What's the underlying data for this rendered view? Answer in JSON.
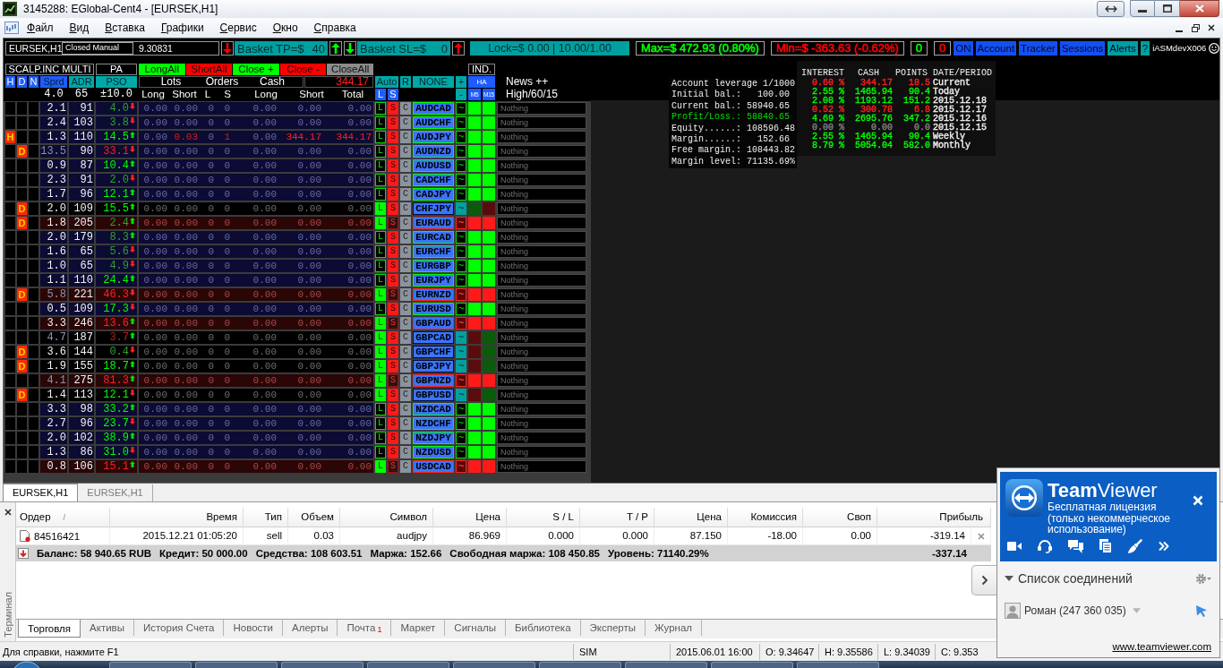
{
  "window": {
    "title": "3145288: EGlobal-Cent4 - [EURSEK,H1]"
  },
  "menu": [
    "Файл",
    "Вид",
    "Вставка",
    "Графики",
    "Сервис",
    "Окно",
    "Справка"
  ],
  "dashboard": {
    "quote": {
      "symbol": "EURSEK,H1",
      "mode": "Closed Manual",
      "price": "9.30831"
    },
    "top_bar": [
      {
        "kind": "down",
        "color": "#ff0000"
      },
      {
        "kind": "basket",
        "label": "Basket TP=$",
        "value": "40"
      },
      {
        "kind": "up",
        "color": "#00ff00"
      },
      {
        "kind": "down",
        "color": "#00ff00"
      },
      {
        "kind": "basket",
        "label": "Basket SL=$",
        "value": "0"
      },
      {
        "kind": "up",
        "color": "#ff0000"
      },
      {
        "kind": "display",
        "text": "Lock=$ 0.00 | 10.00/1.00"
      },
      {
        "kind": "stat",
        "text": "Max=$ 472.93 (0.80%)",
        "color": "#00ff00"
      },
      {
        "kind": "stat",
        "text": "Min=$ -363.63 (-0.62%)",
        "color": "#ff0000"
      },
      {
        "kind": "stat",
        "text": "0",
        "color": "#00ff00"
      },
      {
        "kind": "stat",
        "text": "0",
        "color": "#ff0000"
      },
      {
        "kind": "button",
        "text": "ON",
        "color": "#1450f0"
      },
      {
        "kind": "button",
        "text": "Account",
        "color": "#1450f0"
      },
      {
        "kind": "button",
        "text": "Tracker",
        "color": "#1450f0"
      },
      {
        "kind": "button",
        "text": "Sessions",
        "color": "#1450f0"
      },
      {
        "kind": "button",
        "text": "Alerts",
        "color": "#00a0a0"
      },
      {
        "kind": "button",
        "text": "?",
        "color": "#00a0a0"
      }
    ],
    "user": "iASMdevX006",
    "header": {
      "title": "SCALP.INC MULTI",
      "pa": "PA",
      "actions": [
        {
          "label": "LongAll",
          "color": "#00ff00"
        },
        {
          "label": "ShortAll",
          "color": "#ff0000"
        },
        {
          "label": "Close +",
          "color": "#00ff00"
        },
        {
          "label": "Close -",
          "color": "#ff0000"
        },
        {
          "label": "CloseAll",
          "color": "#8c8c8c"
        }
      ],
      "ind": "IND.",
      "flags": [
        "H",
        "D",
        "N"
      ],
      "metrics": [
        {
          "label": "Sprd",
          "value": "4.0",
          "color": "#1f5cff"
        },
        {
          "label": "ADR",
          "value": "65",
          "color": "#00a8a8"
        },
        {
          "label": "PSO",
          "value": "±10.0",
          "color": "#00a8a8"
        }
      ],
      "groups": [
        "Lots",
        "Orders",
        "Cash"
      ],
      "cash_total": "344.17",
      "subcolumns": [
        "Long",
        "Short",
        "L",
        "S",
        "Long",
        "Short",
        "Total"
      ],
      "mode_buttons": [
        "Auto",
        "R",
        "NONE",
        "+"
      ],
      "sides": [
        "L",
        "S"
      ],
      "minus": "-",
      "ha": "HA",
      "timeframes": [
        "M5",
        "M15"
      ],
      "news": "News ++",
      "news_filter": "High/60/15"
    },
    "rows": [
      {
        "symbol": "AUDCAD",
        "kind": "buy",
        "sprd": "2.1",
        "sprd_high": false,
        "adr": "91",
        "pso": {
          "value": "4.0",
          "bullish": true,
          "strong": false,
          "rising": false
        },
        "values": [
          "0.00",
          "0.00",
          "0",
          "0",
          "0.00",
          "0.00",
          "0.00"
        ],
        "short_open": false,
        "actions": [
          "L",
          "S",
          "C"
        ],
        "mode": "~",
        "ha": [
          {
            "color": "#00ff00"
          },
          {
            "color": "#00ff00"
          }
        ],
        "news": "Nothing"
      },
      {
        "symbol": "AUDCHF",
        "kind": "buy",
        "sprd": "2.4",
        "sprd_high": false,
        "adr": "103",
        "pso": {
          "value": "3.8",
          "bullish": true,
          "strong": false,
          "rising": false
        },
        "values": [
          "0.00",
          "0.00",
          "0",
          "0",
          "0.00",
          "0.00",
          "0.00"
        ],
        "short_open": false,
        "actions": [
          "L",
          "S",
          "C"
        ],
        "mode": "~",
        "ha": [
          {
            "color": "#00ff00"
          },
          {
            "color": "#00ff00"
          }
        ],
        "news": "Nothing"
      },
      {
        "symbol": "AUDJPY",
        "kind": "buy",
        "h_mark": "H",
        "sprd": "1.3",
        "sprd_high": false,
        "adr": "110",
        "pso": {
          "value": "14.5",
          "bullish": true,
          "strong": true,
          "rising": true
        },
        "values": [
          "0.00",
          "0.03",
          "0",
          "1",
          "0.00",
          "344.17",
          "344.17"
        ],
        "short_open": true,
        "actions": [
          "L",
          "S",
          "C"
        ],
        "mode": "~",
        "ha": [
          {
            "color": "#00ff00"
          },
          {
            "color": "#00ff00"
          }
        ],
        "news": "Nothing"
      },
      {
        "symbol": "AUDNZD",
        "kind": "buy",
        "d_mark": "D",
        "sprd": "13.5",
        "sprd_high": true,
        "adr": "90",
        "pso": {
          "value": "33.1",
          "bullish": false,
          "strong": true,
          "rising": false
        },
        "values": [
          "0.00",
          "0.00",
          "0",
          "0",
          "0.00",
          "0.00",
          "0.00"
        ],
        "short_open": false,
        "actions": [
          "L",
          "S",
          "C"
        ],
        "mode": "~",
        "ha": [
          {
            "color": "#00ff00"
          },
          {
            "color": "#00ff00"
          }
        ],
        "news": "Nothing"
      },
      {
        "symbol": "AUDUSD",
        "kind": "buy",
        "sprd": "0.9",
        "sprd_high": false,
        "adr": "87",
        "pso": {
          "value": "10.4",
          "bullish": true,
          "strong": true,
          "rising": true
        },
        "values": [
          "0.00",
          "0.00",
          "0",
          "0",
          "0.00",
          "0.00",
          "0.00"
        ],
        "short_open": false,
        "actions": [
          "L",
          "S",
          "C"
        ],
        "mode": "~",
        "ha": [
          {
            "color": "#00ff00"
          },
          {
            "color": "#00ff00"
          }
        ],
        "news": "Nothing"
      },
      {
        "symbol": "CADCHF",
        "kind": "buy",
        "sprd": "2.3",
        "sprd_high": false,
        "adr": "91",
        "pso": {
          "value": "2.0",
          "bullish": true,
          "strong": false,
          "rising": false
        },
        "values": [
          "0.00",
          "0.00",
          "0",
          "0",
          "0.00",
          "0.00",
          "0.00"
        ],
        "short_open": false,
        "actions": [
          "L",
          "S",
          "C"
        ],
        "mode": "~",
        "ha": [
          {
            "color": "#00ff00"
          },
          {
            "color": "#00ff00"
          }
        ],
        "news": "Nothing"
      },
      {
        "symbol": "CADJPY",
        "kind": "buy",
        "sprd": "1.7",
        "sprd_high": false,
        "adr": "96",
        "pso": {
          "value": "12.1",
          "bullish": true,
          "strong": true,
          "rising": true
        },
        "values": [
          "0.00",
          "0.00",
          "0",
          "0",
          "0.00",
          "0.00",
          "0.00"
        ],
        "short_open": false,
        "actions": [
          "L",
          "S",
          "C"
        ],
        "mode": "~",
        "ha": [
          {
            "color": "#00ff00"
          },
          {
            "color": "#00ff00"
          }
        ],
        "news": "Nothing"
      },
      {
        "symbol": "CHFJPY",
        "kind": "flat",
        "d_mark": "D",
        "sprd": "2.0",
        "sprd_high": false,
        "adr": "109",
        "pso": {
          "value": "15.5",
          "bullish": true,
          "strong": true,
          "rising": true
        },
        "values": [
          "0.00",
          "0.00",
          "0",
          "0",
          "0.00",
          "0.00",
          "0.00"
        ],
        "short_open": false,
        "actions": [
          "L",
          "S",
          "C"
        ],
        "mode": "~",
        "ha": [
          {
            "color": "#0c5a0c"
          },
          {
            "color": "#5a0c0c"
          }
        ],
        "news": "Nothing"
      },
      {
        "symbol": "EURAUD",
        "kind": "sell",
        "d_mark": "D",
        "sprd": "1.8",
        "sprd_high": false,
        "adr": "205",
        "pso": {
          "value": "2.4",
          "bullish": true,
          "strong": false,
          "rising": true
        },
        "values": [
          "0.00",
          "0.00",
          "0",
          "0",
          "0.00",
          "0.00",
          "0.00"
        ],
        "short_open": false,
        "actions": [
          "L",
          "S",
          "C"
        ],
        "mode": "~",
        "ha": [
          {
            "color": "#ff1a1a"
          },
          {
            "color": "#ff1a1a"
          }
        ],
        "news": "Nothing"
      },
      {
        "symbol": "EURCAD",
        "kind": "buy",
        "sprd": "2.0",
        "sprd_high": false,
        "adr": "179",
        "pso": {
          "value": "8.3",
          "bullish": true,
          "strong": false,
          "rising": true
        },
        "values": [
          "0.00",
          "0.00",
          "0",
          "0",
          "0.00",
          "0.00",
          "0.00"
        ],
        "short_open": false,
        "actions": [
          "L",
          "S",
          "C"
        ],
        "mode": "~",
        "ha": [
          {
            "color": "#00ff00"
          },
          {
            "color": "#00ff00"
          }
        ],
        "news": "Nothing"
      },
      {
        "symbol": "EURCHF",
        "kind": "buy",
        "sprd": "1.6",
        "sprd_high": false,
        "adr": "65",
        "pso": {
          "value": "5.6",
          "bullish": true,
          "strong": false,
          "rising": false
        },
        "values": [
          "0.00",
          "0.00",
          "0",
          "0",
          "0.00",
          "0.00",
          "0.00"
        ],
        "short_open": false,
        "actions": [
          "L",
          "S",
          "C"
        ],
        "mode": "~",
        "ha": [
          {
            "color": "#00ff00"
          },
          {
            "color": "#00ff00"
          }
        ],
        "news": "Nothing"
      },
      {
        "symbol": "EURGBP",
        "kind": "buy",
        "sprd": "1.0",
        "sprd_high": false,
        "adr": "65",
        "pso": {
          "value": "4.9",
          "bullish": true,
          "strong": false,
          "rising": false
        },
        "values": [
          "0.00",
          "0.00",
          "0",
          "0",
          "0.00",
          "0.00",
          "0.00"
        ],
        "short_open": false,
        "actions": [
          "L",
          "S",
          "C"
        ],
        "mode": "~",
        "ha": [
          {
            "color": "#00ff00"
          },
          {
            "color": "#00ff00"
          }
        ],
        "news": "Nothing"
      },
      {
        "symbol": "EURJPY",
        "kind": "buy",
        "sprd": "1.1",
        "sprd_high": false,
        "adr": "110",
        "pso": {
          "value": "24.4",
          "bullish": true,
          "strong": true,
          "rising": true
        },
        "values": [
          "0.00",
          "0.00",
          "0",
          "0",
          "0.00",
          "0.00",
          "0.00"
        ],
        "short_open": false,
        "actions": [
          "L",
          "S",
          "C"
        ],
        "mode": "~",
        "ha": [
          {
            "color": "#00ff00"
          },
          {
            "color": "#00ff00"
          }
        ],
        "news": "Nothing"
      },
      {
        "symbol": "EURNZD",
        "kind": "sell",
        "d_mark": "D",
        "sprd": "5.8",
        "sprd_high": true,
        "adr": "221",
        "pso": {
          "value": "46.3",
          "bullish": false,
          "strong": true,
          "rising": false
        },
        "values": [
          "0.00",
          "0.00",
          "0",
          "0",
          "0.00",
          "0.00",
          "0.00"
        ],
        "short_open": false,
        "actions": [
          "L",
          "S",
          "C"
        ],
        "mode": "~",
        "ha": [
          {
            "color": "#ff1a1a"
          },
          {
            "color": "#ff1a1a"
          }
        ],
        "news": "Nothing"
      },
      {
        "symbol": "EURUSD",
        "kind": "buy",
        "sprd": "0.5",
        "sprd_high": false,
        "adr": "109",
        "pso": {
          "value": "17.3",
          "bullish": true,
          "strong": true,
          "rising": false
        },
        "values": [
          "0.00",
          "0.00",
          "0",
          "0",
          "0.00",
          "0.00",
          "0.00"
        ],
        "short_open": false,
        "actions": [
          "L",
          "S",
          "C"
        ],
        "mode": "~",
        "ha": [
          {
            "color": "#00ff00"
          },
          {
            "color": "#00ff00"
          }
        ],
        "news": "Nothing"
      },
      {
        "symbol": "GBPAUD",
        "kind": "sell",
        "sprd": "3.3",
        "sprd_high": false,
        "adr": "246",
        "pso": {
          "value": "13.6",
          "bullish": false,
          "strong": true,
          "rising": true
        },
        "values": [
          "0.00",
          "0.00",
          "0",
          "0",
          "0.00",
          "0.00",
          "0.00"
        ],
        "short_open": false,
        "actions": [
          "L",
          "S",
          "C"
        ],
        "mode": "~",
        "ha": [
          {
            "color": "#ff1a1a"
          },
          {
            "color": "#ff1a1a"
          }
        ],
        "news": "Nothing"
      },
      {
        "symbol": "GBPCAD",
        "kind": "flat",
        "sprd": "4.7",
        "sprd_high": true,
        "adr": "187",
        "pso": {
          "value": "3.7",
          "bullish": false,
          "strong": false,
          "rising": true
        },
        "values": [
          "0.00",
          "0.00",
          "0",
          "0",
          "0.00",
          "0.00",
          "0.00"
        ],
        "short_open": false,
        "actions": [
          "L",
          "S",
          "C"
        ],
        "mode": "~",
        "ha": [
          {
            "color": "#5a0c0c"
          },
          {
            "color": "#0c5a0c"
          }
        ],
        "news": "Nothing"
      },
      {
        "symbol": "GBPCHF",
        "kind": "flat",
        "d_mark": "D",
        "sprd": "3.6",
        "sprd_high": false,
        "adr": "144",
        "pso": {
          "value": "0.4",
          "bullish": true,
          "strong": false,
          "rising": false
        },
        "values": [
          "0.00",
          "0.00",
          "0",
          "0",
          "0.00",
          "0.00",
          "0.00"
        ],
        "short_open": false,
        "actions": [
          "L",
          "S",
          "C"
        ],
        "mode": "~",
        "ha": [
          {
            "color": "#5a0c0c"
          },
          {
            "color": "#0c5a0c"
          }
        ],
        "news": "Nothing"
      },
      {
        "symbol": "GBPJPY",
        "kind": "flat",
        "d_mark": "D",
        "sprd": "1.9",
        "sprd_high": false,
        "adr": "155",
        "pso": {
          "value": "18.7",
          "bullish": true,
          "strong": true,
          "rising": true
        },
        "values": [
          "0.00",
          "0.00",
          "0",
          "0",
          "0.00",
          "0.00",
          "0.00"
        ],
        "short_open": false,
        "actions": [
          "L",
          "S",
          "C"
        ],
        "mode": "~",
        "ha": [
          {
            "color": "#5a0c0c"
          },
          {
            "color": "#0c5a0c"
          }
        ],
        "news": "Nothing"
      },
      {
        "symbol": "GBPNZD",
        "kind": "sell",
        "sprd": "4.1",
        "sprd_high": true,
        "adr": "275",
        "pso": {
          "value": "81.3",
          "bullish": false,
          "strong": true,
          "rising": true
        },
        "values": [
          "0.00",
          "0.00",
          "0",
          "0",
          "0.00",
          "0.00",
          "0.00"
        ],
        "short_open": false,
        "actions": [
          "L",
          "S",
          "C"
        ],
        "mode": "~",
        "ha": [
          {
            "color": "#ff1a1a"
          },
          {
            "color": "#ff1a1a"
          }
        ],
        "news": "Nothing"
      },
      {
        "symbol": "GBPUSD",
        "kind": "flat",
        "d_mark": "D",
        "sprd": "1.4",
        "sprd_high": false,
        "adr": "113",
        "pso": {
          "value": "12.1",
          "bullish": true,
          "strong": true,
          "rising": false
        },
        "values": [
          "0.00",
          "0.00",
          "0",
          "0",
          "0.00",
          "0.00",
          "0.00"
        ],
        "short_open": false,
        "actions": [
          "L",
          "S",
          "C"
        ],
        "mode": "~",
        "ha": [
          {
            "color": "#5a0c0c"
          },
          {
            "color": "#0c5a0c"
          }
        ],
        "news": "Nothing"
      },
      {
        "symbol": "NZDCAD",
        "kind": "buy",
        "sprd": "3.3",
        "sprd_high": false,
        "adr": "98",
        "pso": {
          "value": "33.2",
          "bullish": true,
          "strong": true,
          "rising": true
        },
        "values": [
          "0.00",
          "0.00",
          "0",
          "0",
          "0.00",
          "0.00",
          "0.00"
        ],
        "short_open": false,
        "actions": [
          "L",
          "S",
          "C"
        ],
        "mode": "~",
        "ha": [
          {
            "color": "#00ff00"
          },
          {
            "color": "#00ff00"
          }
        ],
        "news": "Nothing"
      },
      {
        "symbol": "NZDCHF",
        "kind": "buy",
        "sprd": "2.7",
        "sprd_high": false,
        "adr": "96",
        "pso": {
          "value": "23.7",
          "bullish": true,
          "strong": true,
          "rising": false
        },
        "values": [
          "0.00",
          "0.00",
          "0",
          "0",
          "0.00",
          "0.00",
          "0.00"
        ],
        "short_open": false,
        "actions": [
          "L",
          "S",
          "C"
        ],
        "mode": "~",
        "ha": [
          {
            "color": "#00ff00"
          },
          {
            "color": "#00ff00"
          }
        ],
        "news": "Nothing"
      },
      {
        "symbol": "NZDJPY",
        "kind": "buy",
        "sprd": "2.0",
        "sprd_high": false,
        "adr": "102",
        "pso": {
          "value": "38.9",
          "bullish": true,
          "strong": true,
          "rising": true
        },
        "values": [
          "0.00",
          "0.00",
          "0",
          "0",
          "0.00",
          "0.00",
          "0.00"
        ],
        "short_open": false,
        "actions": [
          "L",
          "S",
          "C"
        ],
        "mode": "~",
        "ha": [
          {
            "color": "#00ff00"
          },
          {
            "color": "#00ff00"
          }
        ],
        "news": "Nothing"
      },
      {
        "symbol": "NZDUSD",
        "kind": "buy",
        "sprd": "1.3",
        "sprd_high": false,
        "adr": "86",
        "pso": {
          "value": "31.0",
          "bullish": true,
          "strong": true,
          "rising": false
        },
        "values": [
          "0.00",
          "0.00",
          "0",
          "0",
          "0.00",
          "0.00",
          "0.00"
        ],
        "short_open": false,
        "actions": [
          "L",
          "S",
          "C"
        ],
        "mode": "~",
        "ha": [
          {
            "color": "#00ff00"
          },
          {
            "color": "#00ff00"
          }
        ],
        "news": "Nothing"
      },
      {
        "symbol": "USDCAD",
        "kind": "sell",
        "sprd": "0.8",
        "sprd_high": false,
        "adr": "106",
        "pso": {
          "value": "15.1",
          "bullish": false,
          "strong": true,
          "rising": true
        },
        "values": [
          "0.00",
          "0.00",
          "0",
          "0",
          "0.00",
          "0.00",
          "0.00"
        ],
        "short_open": false,
        "actions": [
          "L",
          "S",
          "C"
        ],
        "mode": "~",
        "ha": [
          {
            "color": "#ff1a1a"
          },
          {
            "color": "#ff1a1a"
          }
        ],
        "news": "Nothing"
      }
    ],
    "account": {
      "title": "Account leverage 1/1000",
      "lines": [
        {
          "label": "Initial bal.:",
          "value": "100.00",
          "highlight": false
        },
        {
          "label": "Current bal.:",
          "value": "58940.65",
          "highlight": false
        },
        {
          "label": "Profit/Loss.:",
          "value": "58840.65",
          "highlight": true
        },
        {
          "label": "Equity......:",
          "value": "108596.48",
          "highlight": false
        },
        {
          "label": "Margin......:",
          "value": "152.66",
          "highlight": false
        },
        {
          "label": "Free margin.:",
          "value": "108443.82",
          "highlight": false
        },
        {
          "label": "Margin level:",
          "value": "71135.69%",
          "highlight": false
        }
      ]
    },
    "stats": {
      "columns": [
        "INTEREST",
        "CASH",
        "POINTS",
        "DATE/PERIOD"
      ],
      "rows": [
        {
          "cells": [
            "0.60 %",
            "344.17",
            "18.5",
            "Current"
          ],
          "color": "#ff2020"
        },
        {
          "cells": [
            "2.55 %",
            "1465.94",
            "90.4",
            "Today"
          ],
          "color": "#00ff00"
        },
        {
          "cells": [
            "2.08 %",
            "1193.12",
            "151.2",
            "2015.12.18"
          ],
          "color": "#00ff00"
        },
        {
          "cells": [
            "0.52 %",
            "300.78",
            "6.8",
            "2015.12.17"
          ],
          "color": "#ff2020"
        },
        {
          "cells": [
            "4.69 %",
            "2695.76",
            "347.2",
            "2015.12.16"
          ],
          "color": "#00ff00"
        },
        {
          "cells": [
            "0.00 %",
            "0.00",
            "0.0",
            "2015.12.15"
          ],
          "color": "#808080"
        },
        {
          "cells": [
            "2.55 %",
            "1465.94",
            "90.4",
            "Weekly"
          ],
          "color": "#00ff00"
        },
        {
          "cells": [
            "8.79 %",
            "5054.04",
            "582.0",
            "Monthly"
          ],
          "color": "#00ff00"
        }
      ]
    }
  },
  "chart_tabs": [
    {
      "label": "EURSEK,H1",
      "selected": true
    },
    {
      "label": "EURSEK,H1",
      "selected": false
    }
  ],
  "terminal": {
    "side_label": "Терминал",
    "columns": [
      "Ордер",
      "Время",
      "Тип",
      "Объем",
      "Символ",
      "Цена",
      "S / L",
      "T / P",
      "Цена",
      "Комиссия",
      "Своп",
      "Прибыль"
    ],
    "sort_mark": "/",
    "orders": [
      {
        "cells": [
          "84516421",
          "2015.12.21 01:05:20",
          "sell",
          "0.03",
          "audjpy",
          "86.969",
          "0.000",
          "0.000",
          "87.150",
          "-18.00",
          "0.00",
          "-319.14"
        ]
      }
    ],
    "summary": [
      "Баланс: 58 940.65 RUB",
      "Кредит: 50 000.00",
      "Средства: 108 603.51",
      "Маржа: 152.66",
      "Свободная маржа: 108 450.85",
      "Уровень: 71140.29%"
    ],
    "summary_total": "-337.14",
    "tabs": [
      {
        "label": "Торговля",
        "selected": true
      },
      {
        "label": "Активы",
        "selected": false
      },
      {
        "label": "История Счета",
        "selected": false
      },
      {
        "label": "Новости",
        "selected": false
      },
      {
        "label": "Алерты",
        "selected": false
      },
      {
        "label": "Почта",
        "selected": false,
        "badge": "1"
      },
      {
        "label": "Маркет",
        "selected": false
      },
      {
        "label": "Сигналы",
        "selected": false
      },
      {
        "label": "Библиотека",
        "selected": false
      },
      {
        "label": "Эксперты",
        "selected": false
      },
      {
        "label": "Журнал",
        "selected": false
      }
    ]
  },
  "status_bar": {
    "help": "Для справки, нажмите F1",
    "fields": [
      "SIM",
      "2015.06.01 16:00",
      "O: 9.34647",
      "H: 9.35586",
      "L: 9.34039",
      "C: 9.353"
    ]
  },
  "teamviewer": {
    "title": "**Team**Viewer",
    "license": "Бесплатная лицензия (только некоммерческое использование)",
    "section": "Список соединений",
    "connections": [
      {
        "name": "Роман (247 360 035)"
      }
    ],
    "link": "www.teamviewer.com"
  }
}
